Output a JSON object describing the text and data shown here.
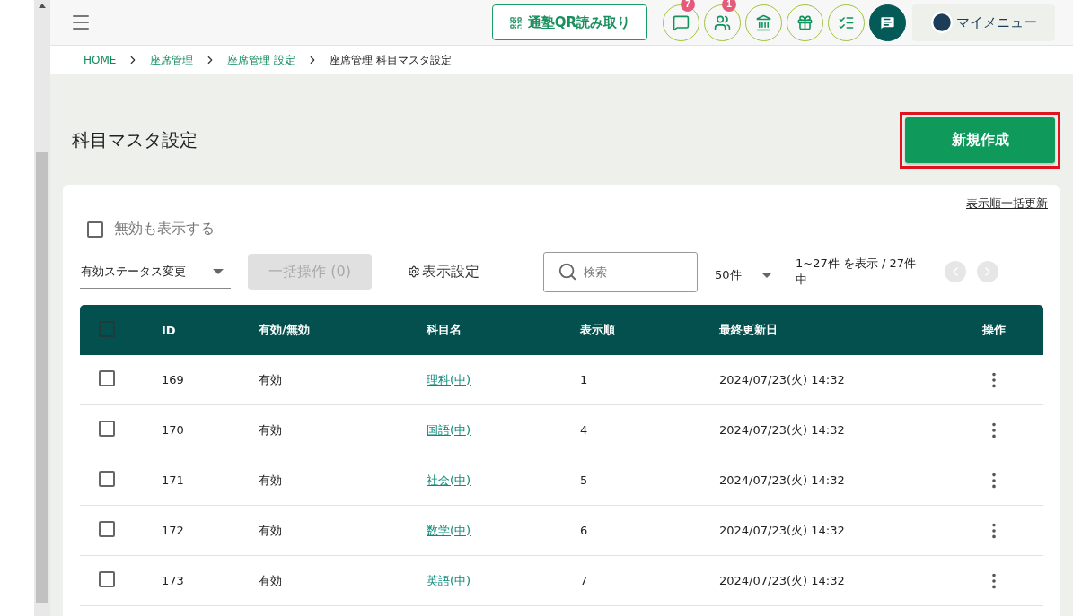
{
  "header": {
    "qr_button": "通塾QR読み取り",
    "icon_buttons": [
      {
        "kind": "chat",
        "badge": "7"
      },
      {
        "kind": "people",
        "badge": "1"
      },
      {
        "kind": "school"
      },
      {
        "kind": "gift"
      },
      {
        "kind": "checklist"
      },
      {
        "kind": "message",
        "filled": true
      }
    ],
    "my_menu": "マイメニュー"
  },
  "breadcrumb": [
    {
      "label": "HOME",
      "link": true
    },
    {
      "label": "座席管理",
      "link": true
    },
    {
      "label": "座席管理 設定",
      "link": true
    },
    {
      "label": "座席管理 科目マスタ設定",
      "link": false
    }
  ],
  "page_title": "科目マスタ設定",
  "create_button": {
    "label": "新規作成",
    "highlighted": true
  },
  "bulk_order_link": "表示順一括更新",
  "show_inactive": {
    "label": "無効も表示する",
    "checked": false
  },
  "status_select": "有効ステータス変更",
  "bulk_button": {
    "label": "一括操作 (0)",
    "disabled": true
  },
  "display_settings": "表示設定",
  "search": {
    "placeholder": "検索"
  },
  "per_page": "50件",
  "range_text": "1~27件 を表示 / 27件中",
  "table": {
    "columns": [
      "ID",
      "有効/無効",
      "科目名",
      "表示順",
      "最終更新日",
      "操作"
    ],
    "header_checked": false,
    "rows": [
      {
        "checked": false,
        "id": "169",
        "status": "有効",
        "name": "理科(中)",
        "order": "1",
        "updated": "2024/07/23(火) 14:32"
      },
      {
        "checked": false,
        "id": "170",
        "status": "有効",
        "name": "国語(中)",
        "order": "4",
        "updated": "2024/07/23(火) 14:32"
      },
      {
        "checked": false,
        "id": "171",
        "status": "有効",
        "name": "社会(中)",
        "order": "5",
        "updated": "2024/07/23(火) 14:32"
      },
      {
        "checked": false,
        "id": "172",
        "status": "有効",
        "name": "数学(中)",
        "order": "6",
        "updated": "2024/07/23(火) 14:32"
      },
      {
        "checked": false,
        "id": "173",
        "status": "有効",
        "name": "英語(中)",
        "order": "7",
        "updated": "2024/07/23(火) 14:32"
      }
    ]
  }
}
